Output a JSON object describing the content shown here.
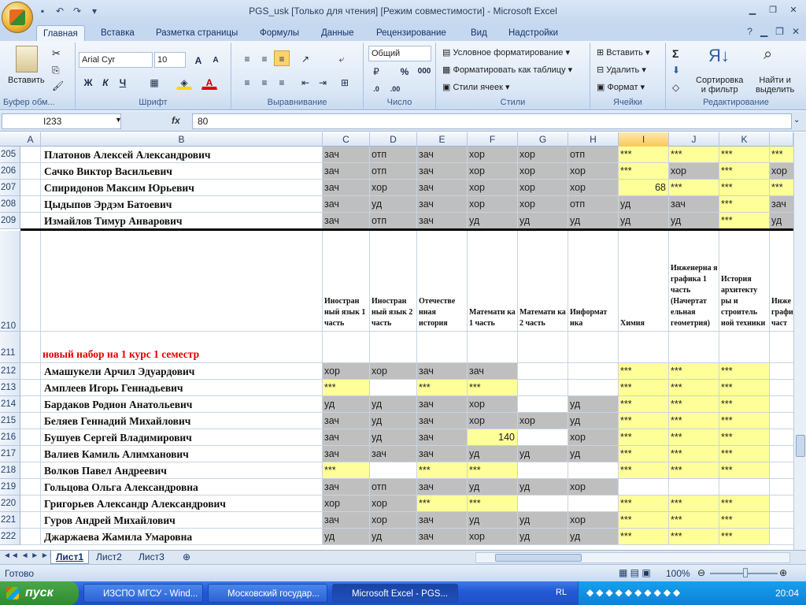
{
  "window": {
    "title": "PGS_usk  [Только для чтения]  [Режим совместимости] - Microsoft Excel"
  },
  "ribbon": {
    "tabs": [
      "Главная",
      "Вставка",
      "Разметка страницы",
      "Формулы",
      "Данные",
      "Рецензирование",
      "Вид",
      "Надстройки"
    ],
    "clipboard": {
      "paste": "Вставить",
      "group": "Буфер обм..."
    },
    "font": {
      "name": "Arial Cyr",
      "size": "10",
      "bold": "Ж",
      "italic": "К",
      "underline": "Ч",
      "group": "Шрифт"
    },
    "alignment": {
      "group": "Выравнивание"
    },
    "number": {
      "format": "Общий",
      "percent": "%",
      "thousands": "000",
      "group": "Число"
    },
    "styles": {
      "conditional": "Условное форматирование",
      "table": "Форматировать как таблицу",
      "cell_styles": "Стили ячеек",
      "group": "Стили"
    },
    "cells": {
      "insert": "Вставить",
      "delete": "Удалить",
      "format": "Формат",
      "group": "Ячейки"
    },
    "editing": {
      "sum": "Σ",
      "sort": "Сортировка\nи фильтр",
      "sort1": "Сортировка",
      "sort2": "и фильтр",
      "find1": "Найти и",
      "find2": "выделить",
      "group": "Редактирование"
    }
  },
  "formula_bar": {
    "name_box": "I233",
    "fx": "fx",
    "value": "80"
  },
  "columns": [
    "A",
    "B",
    "C",
    "D",
    "E",
    "F",
    "G",
    "H",
    "I",
    "J",
    "K"
  ],
  "selected_column": "I",
  "rows_top": [
    {
      "num": "205",
      "name": "Платонов Алексей Александрович",
      "c": "зач",
      "d": "отп",
      "e": "зач",
      "f": "хор",
      "g": "хор",
      "h": "отп",
      "i": "***",
      "j": "***",
      "k": "***",
      "l": "***"
    },
    {
      "num": "206",
      "name": "Сачко Виктор Васильевич",
      "c": "зач",
      "d": "отп",
      "e": "зач",
      "f": "хор",
      "g": "хор",
      "h": "хор",
      "i": "***",
      "j": "хор",
      "k": "***",
      "l": "хор"
    },
    {
      "num": "207",
      "name": "Спиридонов Максим Юрьевич",
      "c": "зач",
      "d": "хор",
      "e": "зач",
      "f": "хор",
      "g": "хор",
      "h": "хор",
      "i": "68",
      "j": "***",
      "k": "***",
      "l": "***"
    },
    {
      "num": "208",
      "name": "Цыдыпов Эрдэм Батоевич",
      "c": "зач",
      "d": "уд",
      "e": "зач",
      "f": "хор",
      "g": "хор",
      "h": "отп",
      "i": "уд",
      "j": "зач",
      "k": "***",
      "l": "зач"
    },
    {
      "num": "209",
      "name": "Измайлов Тимур Анварович",
      "c": "зач",
      "d": "отп",
      "e": "зач",
      "f": "уд",
      "g": "уд",
      "h": "уд",
      "i": "уд",
      "j": "уд",
      "k": "***",
      "l": "уд"
    }
  ],
  "header_row": {
    "num": "210",
    "c": "Иностран ный язык 1 часть",
    "d": "Иностран ный язык 2 часть",
    "e": "Отечестве нная история",
    "f": "Математи ка 1 часть",
    "g": "Математи ка 2 часть",
    "h": "Информат ика",
    "i": "Химия",
    "j": "Инженерна я графика 1 часть (Начертат ельная геометрия)",
    "k": "История архитекту ры и строитель ной техники",
    "l": "Инже графи 2 част"
  },
  "section_row": {
    "num": "211",
    "label": "новый набор на 1 курс 1 семестр"
  },
  "rows_bottom": [
    {
      "num": "212",
      "name": "Амашукели Арчил Эдуардович",
      "c": "хор",
      "d": "хор",
      "e": "зач",
      "f": "зач",
      "g": "",
      "h": "",
      "i": "***",
      "j": "***",
      "k": "***"
    },
    {
      "num": "213",
      "name": "Амплеев Игорь Геннадьевич",
      "c": "***",
      "d": "",
      "e": "***",
      "f": "***",
      "g": "",
      "h": "",
      "i": "***",
      "j": "***",
      "k": "***"
    },
    {
      "num": "214",
      "name": "Бардаков Родион Анатольевич",
      "c": "уд",
      "d": "уд",
      "e": "зач",
      "f": "хор",
      "g": "",
      "h": "уд",
      "i": "***",
      "j": "***",
      "k": "***"
    },
    {
      "num": "215",
      "name": "Беляев Геннадий Михайлович",
      "c": "зач",
      "d": "уд",
      "e": "зач",
      "f": "хор",
      "g": "хор",
      "h": "уд",
      "i": "***",
      "j": "***",
      "k": "***"
    },
    {
      "num": "216",
      "name": "Бушуев Сергей Владимирович",
      "c": "зач",
      "d": "уд",
      "e": "зач",
      "f": "140",
      "g": "",
      "h": "хор",
      "i": "***",
      "j": "***",
      "k": "***"
    },
    {
      "num": "217",
      "name": "Валиев Камиль Алимханович",
      "c": "зач",
      "d": "зач",
      "e": "зач",
      "f": "уд",
      "g": "уд",
      "h": "уд",
      "i": "***",
      "j": "***",
      "k": "***"
    },
    {
      "num": "218",
      "name": "Волков Павел Андреевич",
      "c": "***",
      "d": "",
      "e": "***",
      "f": "***",
      "g": "",
      "h": "",
      "i": "***",
      "j": "***",
      "k": "***"
    },
    {
      "num": "219",
      "name": "Гольцова Ольга Александровна",
      "c": "зач",
      "d": "отп",
      "e": "зач",
      "f": "уд",
      "g": "уд",
      "h": "хор",
      "i": "",
      "j": "",
      "k": ""
    },
    {
      "num": "220",
      "name": "Григорьев Александр Александрович",
      "c": "хор",
      "d": "хор",
      "e": "***",
      "f": "***",
      "g": "",
      "h": "",
      "i": "***",
      "j": "***",
      "k": "***"
    },
    {
      "num": "221",
      "name": "Гуров Андрей Михайлович",
      "c": "зач",
      "d": "хор",
      "e": "зач",
      "f": "уд",
      "g": "уд",
      "h": "хор",
      "i": "***",
      "j": "***",
      "k": "***"
    },
    {
      "num": "222",
      "name": "Джаржаева Жамила Умаровна",
      "c": "уд",
      "d": "уд",
      "e": "зач",
      "f": "хор",
      "g": "уд",
      "h": "уд",
      "i": "***",
      "j": "***",
      "k": "***"
    }
  ],
  "sheet_tabs": [
    "Лист1",
    "Лист2",
    "Лист3"
  ],
  "status": {
    "ready": "Готово",
    "zoom": "100%"
  },
  "taskbar": {
    "start": "пуск",
    "tasks": [
      "ИЗСПО МГСУ - Wind...",
      "Московский государ...",
      "Microsoft Excel - PGS..."
    ],
    "lang": "RL",
    "clock": "20:04"
  }
}
